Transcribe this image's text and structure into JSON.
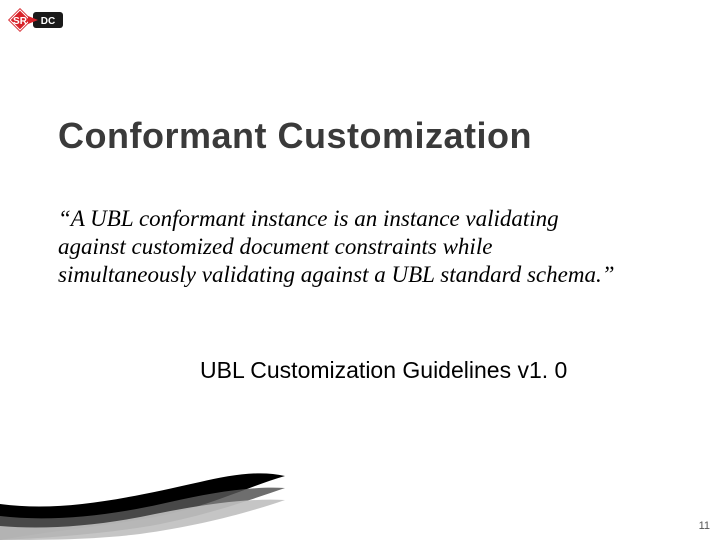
{
  "logo": {
    "name": "srdc-logo",
    "left_text": "SR",
    "right_text": "DC",
    "colors": {
      "red": "#d8232a",
      "dark": "#1a1a1a",
      "white": "#ffffff"
    }
  },
  "title": "Conformant Customization",
  "quote_text": "“A UBL conformant instance is an instance validating against customized document constraints while simultaneously validating against a UBL standard schema.”",
  "attribution": "UBL Customization Guidelines v1. 0",
  "page_number": "11"
}
